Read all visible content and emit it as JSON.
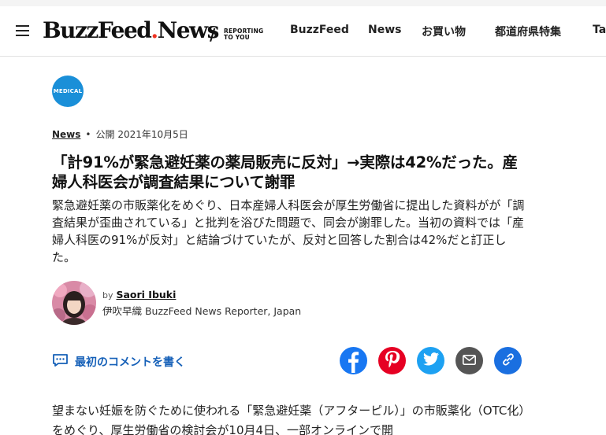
{
  "header": {
    "logo_text": "BuzzFeed",
    "logo_text2": "News",
    "slash": "/",
    "tagline_line1": "REPORTING",
    "tagline_line2": "TO YOU",
    "nav": [
      {
        "label": "BuzzFeed"
      },
      {
        "label": "News"
      },
      {
        "label": "お買い物"
      },
      {
        "label": "都道府県特集"
      },
      {
        "label": "Ta"
      }
    ]
  },
  "article": {
    "badge": "MEDICAL",
    "section": "News",
    "separator": "•",
    "published": "公開 2021年10月5日",
    "title": "「計91%が緊急避妊薬の薬局販売に反対」→実際は42%だった。産婦人科医会が調査結果について謝罪",
    "description": "緊急避妊薬の市販薬化をめぐり、日本産婦人科医会が厚生労働省に提出した資料がが「調査結果が歪曲されている」と批判を浴びた問題で、同会が謝罪した。当初の資料では「産婦人科医の91%が反対」と結論づけていたが、反対と回答した割合は42%だと訂正した。",
    "author": {
      "by": "by",
      "name": "Saori Ibuki",
      "role": "伊吹早織 BuzzFeed News Reporter, Japan"
    },
    "comment_label": "最初のコメントを書く",
    "body": "望まない妊娠を防ぐために使われる「緊急避妊薬（アフターピル）」の市販薬化（OTC化）をめぐり、厚生労働省の検討会が10月4日、一部オンラインで開"
  },
  "share": [
    {
      "icon": "facebook-icon",
      "color": "#1877f2"
    },
    {
      "icon": "pinterest-icon",
      "color": "#e60023"
    },
    {
      "icon": "twitter-icon",
      "color": "#1da1f2"
    },
    {
      "icon": "mail-icon",
      "color": "#555555"
    },
    {
      "icon": "link-icon",
      "color": "#1a6fe0"
    }
  ]
}
